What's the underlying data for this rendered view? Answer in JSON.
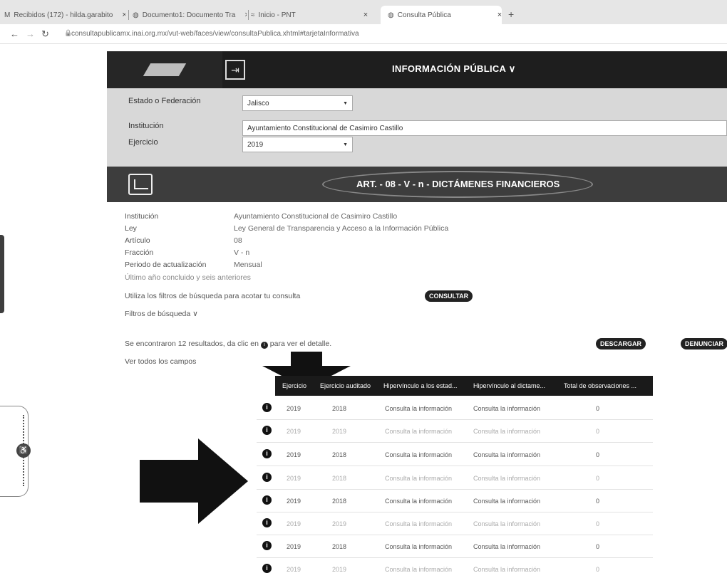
{
  "browser": {
    "tabs": [
      {
        "label": "Recibidos (172) - hilda.garabito",
        "icon": "gmail-icon"
      },
      {
        "label": "Documento1: Documento Tra",
        "icon": "globe-icon"
      },
      {
        "label": "Inicio - PNT",
        "icon": "pnt-icon"
      },
      {
        "label": "Consulta Pública",
        "icon": "globe-icon"
      }
    ],
    "close_glyph": "×",
    "new_tab_glyph": "+",
    "url": "consultapublicamx.inai.org.mx/vut-web/faces/view/consultaPublica.xhtml#tarjetaInformativa"
  },
  "header": {
    "title": "INFORMACIÓN PÚBLICA",
    "chevron": "∨"
  },
  "filters": {
    "estado_label": "Estado o Federación",
    "estado_value": "Jalisco",
    "institucion_label": "Institución",
    "institucion_value": "Ayuntamiento Constitucional de Casimiro Castillo",
    "ejercicio_label": "Ejercicio",
    "ejercicio_value": "2019"
  },
  "section": {
    "title": "ART. - 08 - V - n - DICTÁMENES FINANCIEROS"
  },
  "info": {
    "rows": [
      {
        "label": "Institución",
        "value": "Ayuntamiento Constitucional de Casimiro Castillo"
      },
      {
        "label": "Ley",
        "value": "Ley General de Transparencia y Acceso a la Información Pública"
      },
      {
        "label": "Artículo",
        "value": "08"
      },
      {
        "label": "Fracción",
        "value": "V - n"
      },
      {
        "label": "Periodo de actualización",
        "value": "Mensual"
      }
    ],
    "note": "Último año concluido y seis anteriores",
    "filter_hint": "Utiliza los filtros de búsqueda para acotar tu consulta",
    "consultar_label": "CONSULTAR",
    "filtros_label": "Filtros de búsqueda ∨",
    "results_text_a": "Se encontraron 12 resultados, da clic en",
    "results_text_b": "para ver el detalle.",
    "descargar_label": "DESCARGAR",
    "denunciar_label": "DENUNCIAR",
    "ver_campos": "Ver todos los campos"
  },
  "table": {
    "headers": [
      "Ejercicio",
      "Ejercicio auditado",
      "Hipervínculo a los estad...",
      "Hipervínculo al dictame...",
      "Total de observaciones ..."
    ],
    "rows": [
      {
        "ejercicio": "2019",
        "auditado": "2018",
        "estados": "Consulta la información",
        "dictamen": "Consulta la información",
        "total": "0"
      },
      {
        "ejercicio": "2019",
        "auditado": "2019",
        "estados": "Consulta la información",
        "dictamen": "Consulta la información",
        "total": "0"
      },
      {
        "ejercicio": "2019",
        "auditado": "2018",
        "estados": "Consulta la información",
        "dictamen": "Consulta la información",
        "total": "0"
      },
      {
        "ejercicio": "2019",
        "auditado": "2018",
        "estados": "Consulta la información",
        "dictamen": "Consulta la información",
        "total": "0"
      },
      {
        "ejercicio": "2019",
        "auditado": "2018",
        "estados": "Consulta la información",
        "dictamen": "Consulta la información",
        "total": "0"
      },
      {
        "ejercicio": "2019",
        "auditado": "2019",
        "estados": "Consulta la información",
        "dictamen": "Consulta la información",
        "total": "0"
      },
      {
        "ejercicio": "2019",
        "auditado": "2018",
        "estados": "Consulta la información",
        "dictamen": "Consulta la información",
        "total": "0"
      },
      {
        "ejercicio": "2019",
        "auditado": "2019",
        "estados": "Consulta la información",
        "dictamen": "Consulta la información",
        "total": "0"
      }
    ],
    "info_glyph": "i"
  }
}
